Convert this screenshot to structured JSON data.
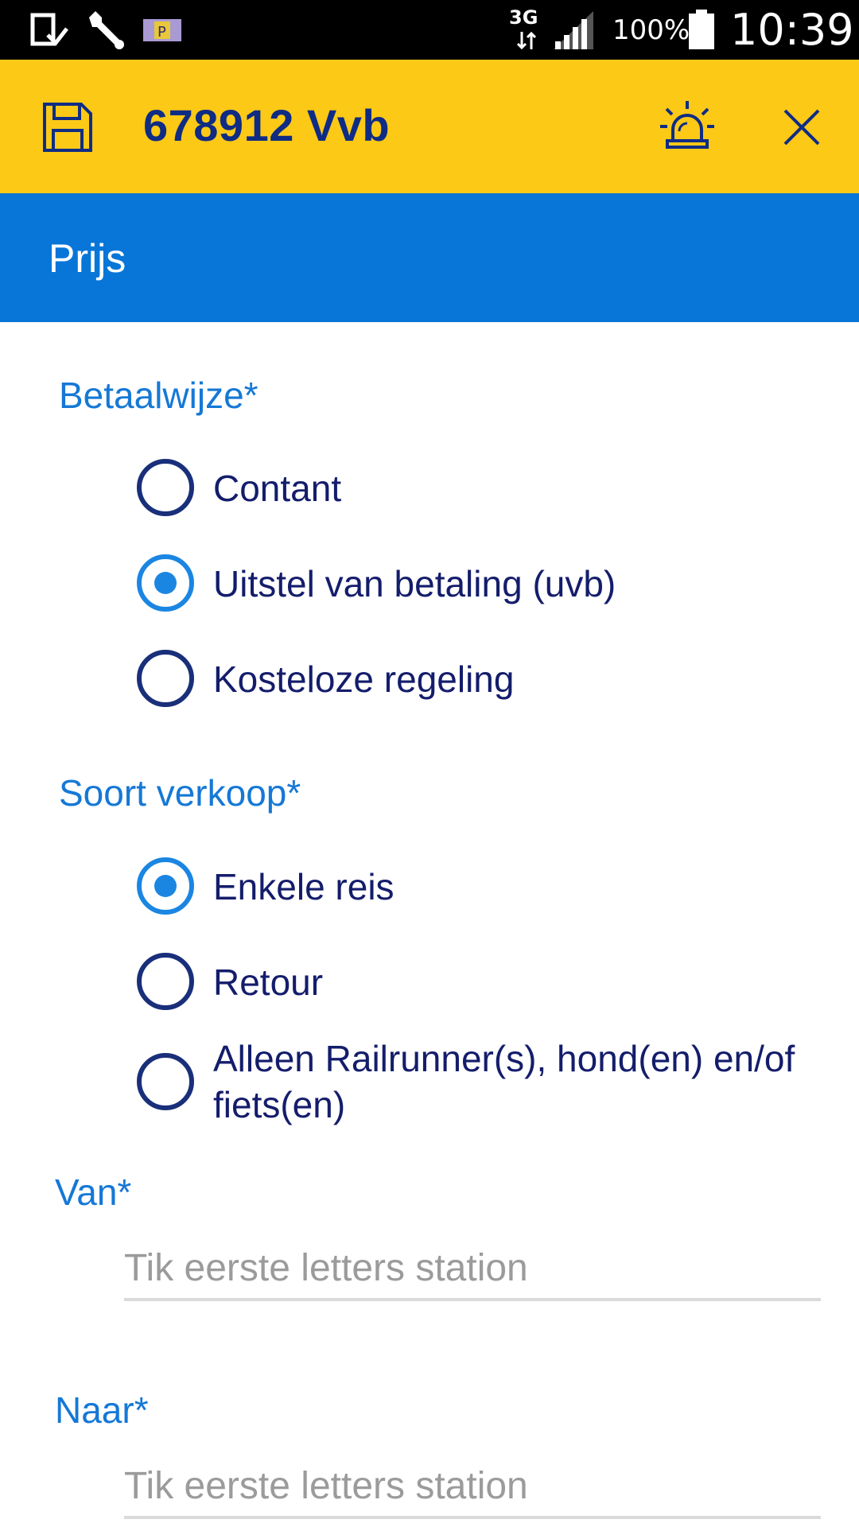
{
  "status_bar": {
    "network": "3G",
    "battery": "100%",
    "time": "10:39"
  },
  "header": {
    "title": "678912 Vvb",
    "save_icon": "floppy-disk-icon",
    "alarm_icon": "siren-icon",
    "close_icon": "close-icon"
  },
  "section": {
    "title": "Prijs"
  },
  "betaalwijze": {
    "label": "Betaalwijze*",
    "options": [
      {
        "label": "Contant",
        "selected": false
      },
      {
        "label": "Uitstel van betaling (uvb)",
        "selected": true
      },
      {
        "label": "Kosteloze regeling",
        "selected": false
      }
    ]
  },
  "soort_verkoop": {
    "label": "Soort verkoop*",
    "options": [
      {
        "label": "Enkele reis",
        "selected": true
      },
      {
        "label": "Retour",
        "selected": false
      },
      {
        "label": "Alleen Railrunner(s), hond(en) en/of fiets(en)",
        "selected": false
      }
    ]
  },
  "van": {
    "label": "Van*",
    "value": "",
    "placeholder": "Tik eerste letters station"
  },
  "naar": {
    "label": "Naar*",
    "value": "",
    "placeholder": "Tik eerste letters station"
  },
  "colors": {
    "header_bg": "#fcc917",
    "section_bg": "#0876d8",
    "accent": "#1b86e2",
    "title_text": "#0f2c84"
  }
}
